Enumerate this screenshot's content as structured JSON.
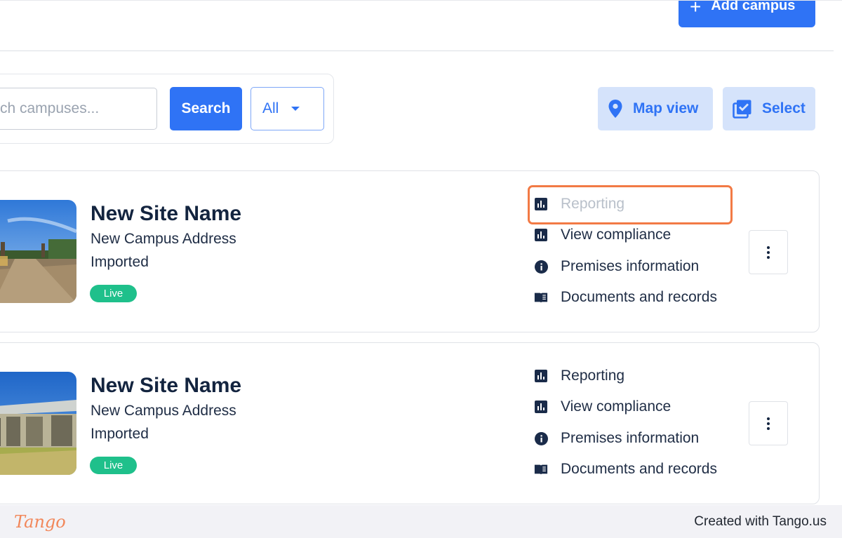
{
  "header": {
    "add_campus_label": "Add campus"
  },
  "search": {
    "placeholder": "rch campuses...",
    "button_label": "Search",
    "filter_value": "All"
  },
  "toolbar": {
    "map_view_label": "Map view",
    "select_label": "Select"
  },
  "actions": {
    "reporting": "Reporting",
    "view_compliance": "View compliance",
    "premises_information": "Premises information",
    "documents_records": "Documents and records"
  },
  "campuses": [
    {
      "site_name": "New Site Name",
      "address": "New Campus Address",
      "source": "Imported",
      "status": "Live"
    },
    {
      "site_name": "New Site Name",
      "address": "New Campus Address",
      "source": "Imported",
      "status": "Live"
    }
  ],
  "footer": {
    "logo": "Tango",
    "credit": "Created with Tango.us"
  },
  "colors": {
    "primary": "#2f73f5",
    "live": "#1fc08b",
    "highlight": "#f27a45",
    "light_button": "#d5e3fb"
  }
}
